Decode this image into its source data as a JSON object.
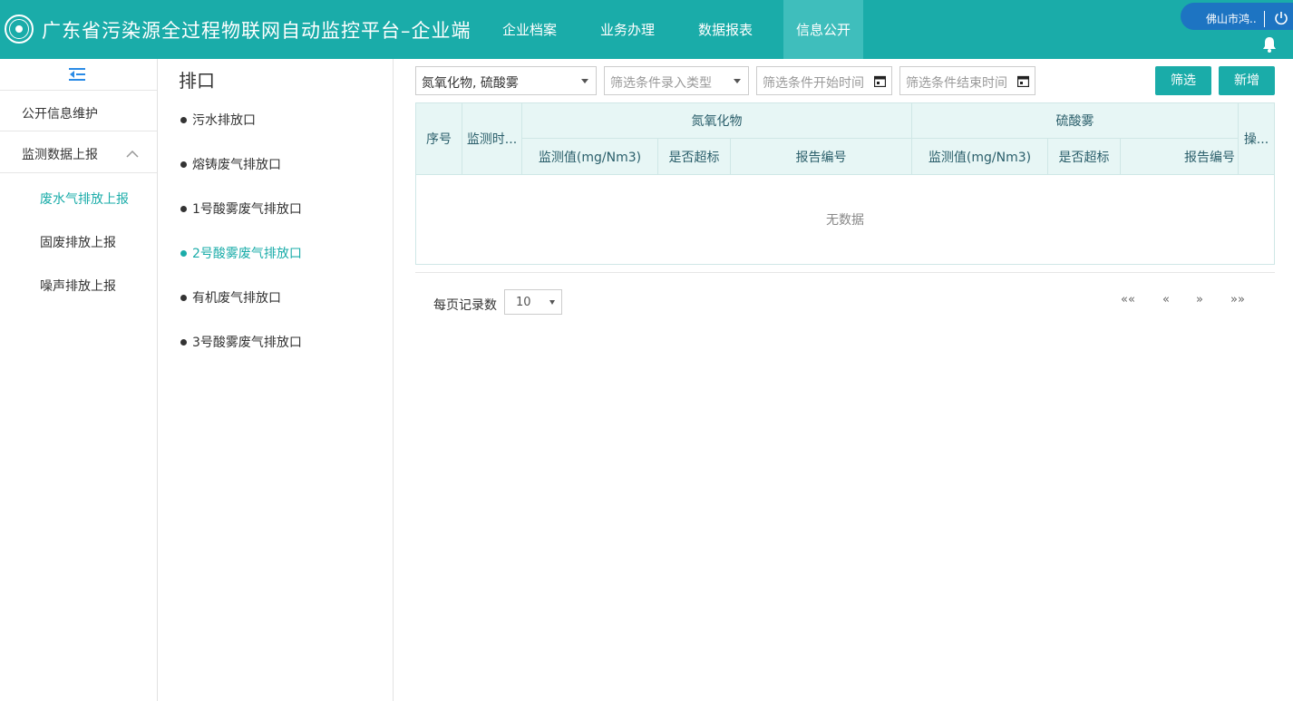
{
  "header": {
    "title": "广东省污染源全过程物联网自动监控平台–企业端",
    "nav": [
      "企业档案",
      "业务办理",
      "数据报表",
      "信息公开"
    ],
    "active_nav": "信息公开",
    "user": "佛山市鸿..",
    "colors": {
      "primary": "#1aaca9",
      "active_tab": "#3fbebc",
      "user_pill": "#1d74c2"
    }
  },
  "sidebar": {
    "items": [
      {
        "label": "公开信息维护"
      },
      {
        "label": "监测数据上报",
        "expanded": true
      }
    ],
    "subitems": [
      {
        "label": "废水气排放上报",
        "active": true
      },
      {
        "label": "固废排放上报"
      },
      {
        "label": "噪声排放上报"
      }
    ]
  },
  "outlets": {
    "title": "排口",
    "items": [
      {
        "label": "污水排放口"
      },
      {
        "label": "熔铸废气排放口"
      },
      {
        "label": "1号酸雾废气排放口"
      },
      {
        "label": "2号酸雾废气排放口",
        "active": true
      },
      {
        "label": "有机废气排放口"
      },
      {
        "label": "3号酸雾废气排放口"
      }
    ]
  },
  "filters": {
    "pollutants_value": "氮氧化物, 硫酸雾",
    "entry_type_placeholder": "筛选条件录入类型",
    "start_time_placeholder": "筛选条件开始时间",
    "end_time_placeholder": "筛选条件结束时间",
    "filter_button": "筛选",
    "add_button": "新增"
  },
  "table": {
    "headers": {
      "seq": "序号",
      "time": "监测时...",
      "group1": "氮氧化物",
      "group2": "硫酸雾",
      "ops": "操...",
      "sub": [
        "监测值(mg/Nm3)",
        "是否超标",
        "报告编号"
      ]
    },
    "empty_text": "无数据"
  },
  "pager": {
    "page_size_label": "每页记录数",
    "page_size": "10",
    "first": "««",
    "prev": "«",
    "next": "»",
    "last": "»»"
  }
}
